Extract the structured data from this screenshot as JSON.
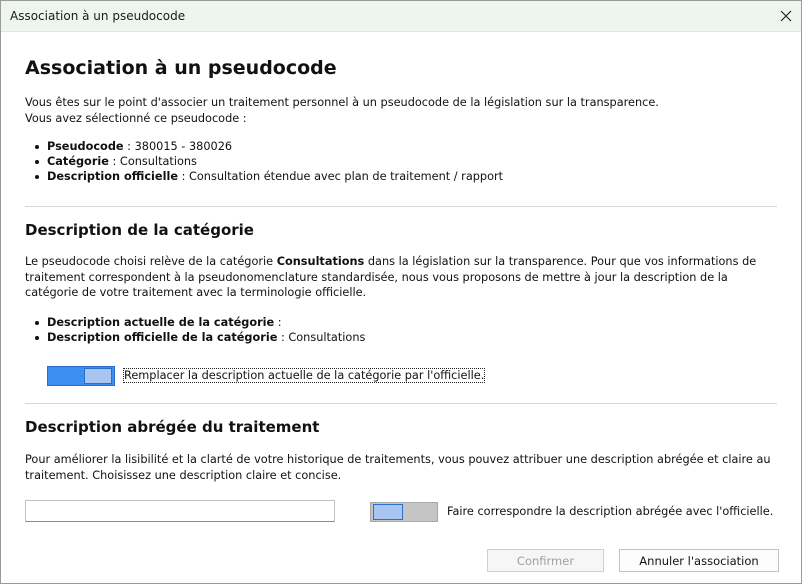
{
  "window": {
    "title": "Association à un pseudocode"
  },
  "heading": "Association à un pseudocode",
  "intro": {
    "line1": "Vous êtes sur le point d'associer un traitement personnel à un pseudocode de la législation sur la transparence.",
    "line2": "Vous avez sélectionné ce pseudocode :"
  },
  "selected": {
    "pseudocode_label": "Pseudocode",
    "pseudocode_value": " : 380015 - 380026",
    "categorie_label": "Catégorie",
    "categorie_value": " : Consultations",
    "description_label": "Description officielle",
    "description_value": " : Consultation étendue avec plan de traitement / rapport"
  },
  "category_section": {
    "title": "Description de la catégorie",
    "text_before": "Le pseudocode choisi relève de la catégorie ",
    "text_bold": "Consultations",
    "text_after": " dans la législation sur la transparence. Pour que vos informations de traitement correspondent à la pseudonomenclature standardisée, nous vous proposons de mettre à jour la description de la catégorie de votre traitement avec la terminologie officielle.",
    "current_label": "Description actuelle de la catégorie",
    "current_value": " :",
    "official_label": "Description officielle de la catégorie",
    "official_value": " : Consultations",
    "toggle_label": "Remplacer la description actuelle de la catégorie par l'officielle.",
    "toggle_on": true
  },
  "short_section": {
    "title": "Description abrégée du traitement",
    "text": "Pour améliorer la lisibilité et la clarté de votre historique de traitements, vous pouvez attribuer une description abrégée et claire au traitement. Choisissez une description claire et concise.",
    "input_value": "",
    "toggle_label": "Faire correspondre la description abrégée avec l'officielle.",
    "toggle_on": false
  },
  "buttons": {
    "confirm": "Confirmer",
    "cancel": "Annuler l'association"
  }
}
